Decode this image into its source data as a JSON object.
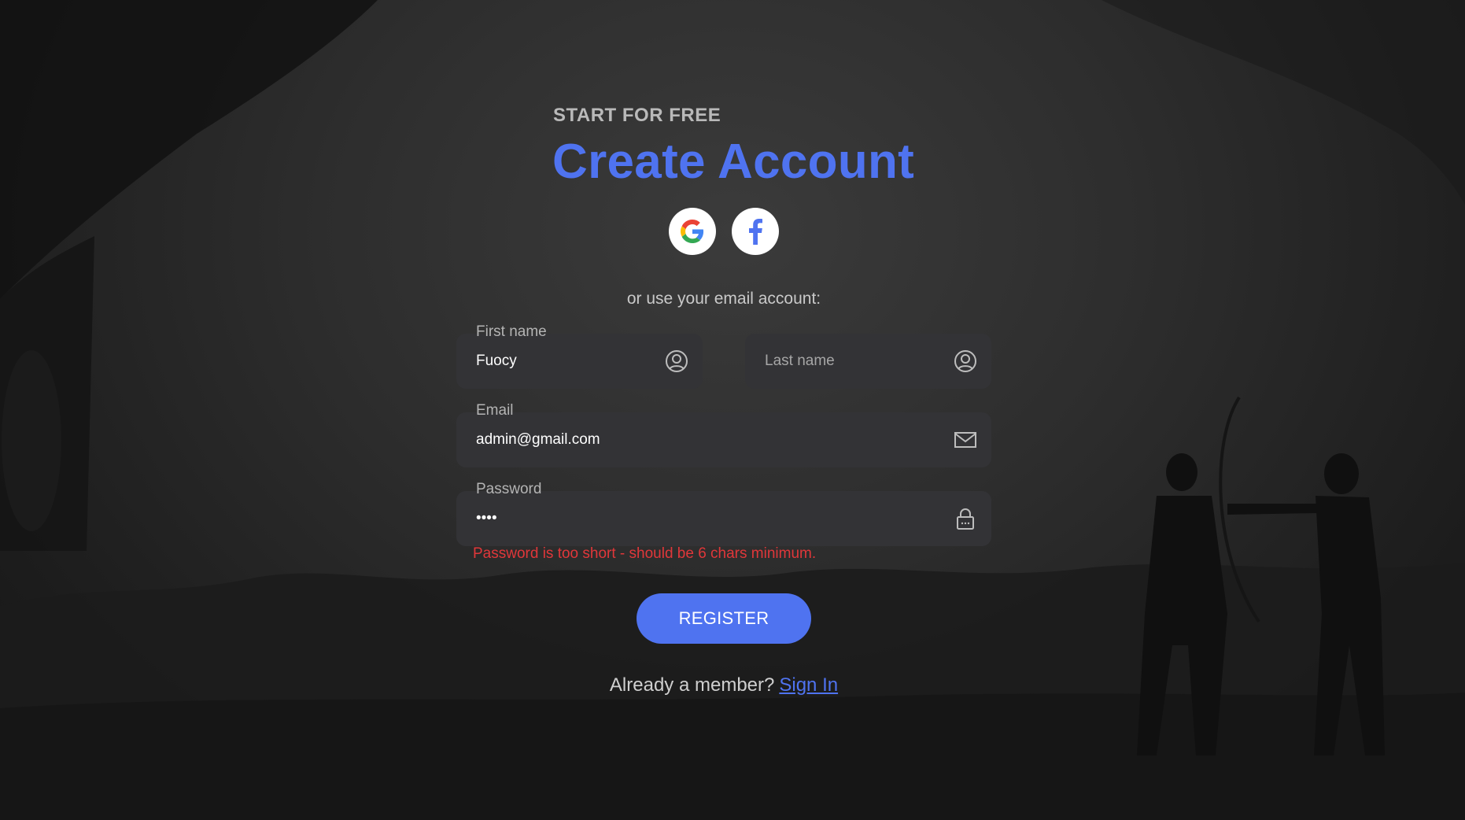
{
  "header": {
    "kicker": "START FOR FREE",
    "title": "Create Account"
  },
  "social": {
    "google_icon": "google-icon",
    "facebook_icon": "facebook-icon"
  },
  "divider_text": "or use your email account:",
  "form": {
    "first_name": {
      "label": "First name",
      "value": "Fuocy",
      "icon": "user-circle-icon"
    },
    "last_name": {
      "label": "",
      "placeholder": "Last name",
      "value": "",
      "icon": "user-circle-icon"
    },
    "email": {
      "label": "Email",
      "value": "admin@gmail.com",
      "icon": "envelope-icon"
    },
    "password": {
      "label": "Password",
      "value": "••••",
      "icon": "lock-icon"
    },
    "error": "Password is too short - should be 6 chars minimum.",
    "register_label": "REGISTER"
  },
  "footer": {
    "prompt": "Already a member?",
    "link": "Sign In"
  },
  "colors": {
    "accent": "#4f73f0",
    "error": "#e0373a",
    "field_bg": "#333336"
  }
}
